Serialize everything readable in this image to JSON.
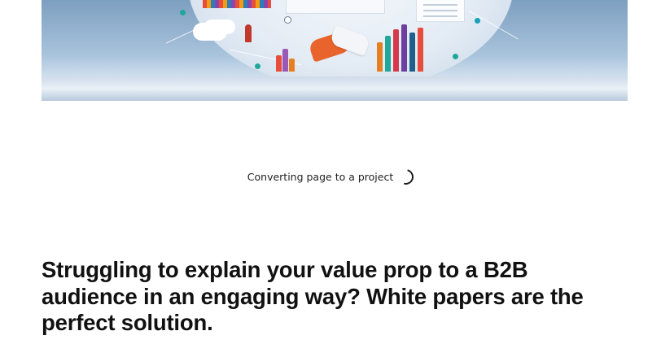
{
  "hero": {
    "image_description_icons": [
      "handshake-icon",
      "cloud-icon",
      "bar-chart-icon",
      "document-icon",
      "person-icon"
    ],
    "colors": {
      "sky": "#8fb0cf",
      "floor": "#e9f0f7",
      "hand_orange": "#e8642c",
      "bar_teal": "#1fa79a",
      "bar_red": "#d63a4a",
      "bar_purple": "#6c3fa0"
    }
  },
  "status": {
    "text": "Converting page to a project"
  },
  "headline": {
    "text": "Struggling to explain your value prop to a B2B audience in an engaging way? White papers are the perfect solution."
  }
}
